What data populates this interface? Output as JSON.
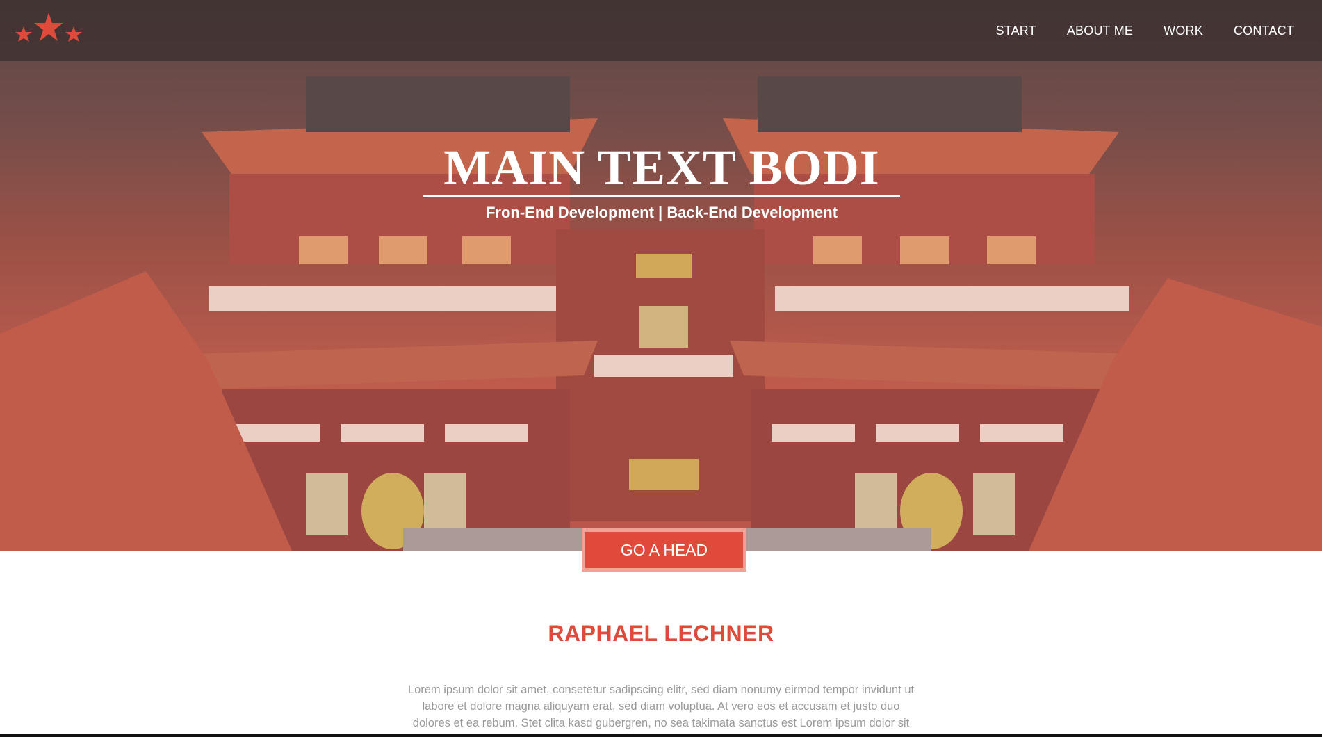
{
  "nav": {
    "items": [
      {
        "label": "START"
      },
      {
        "label": "ABOUT ME"
      },
      {
        "label": "WORK"
      },
      {
        "label": "CONTACT"
      }
    ]
  },
  "hero": {
    "title": "MAIN TEXT BODI",
    "subtitle": "Fron-End Development | Back-End Development",
    "cta_label": "GO A HEAD"
  },
  "about": {
    "name": "RAPHAEL LECHNER",
    "body": "Lorem ipsum dolor sit amet, consetetur sadipscing elitr, sed diam nonumy eirmod tempor invidunt ut labore et dolore magna aliquyam erat, sed diam voluptua. At vero eos et accusam et justo duo dolores et ea rebum. Stet clita kasd gubergren, no sea takimata sanctus est Lorem ipsum dolor sit amet. Lorem"
  },
  "colors": {
    "accent": "#e04a3a",
    "cta_border": "#f2a197",
    "nav_bg": "#3c3030",
    "body_text": "#9a9a9a"
  },
  "icons": {
    "logo": "three-stars-icon"
  }
}
